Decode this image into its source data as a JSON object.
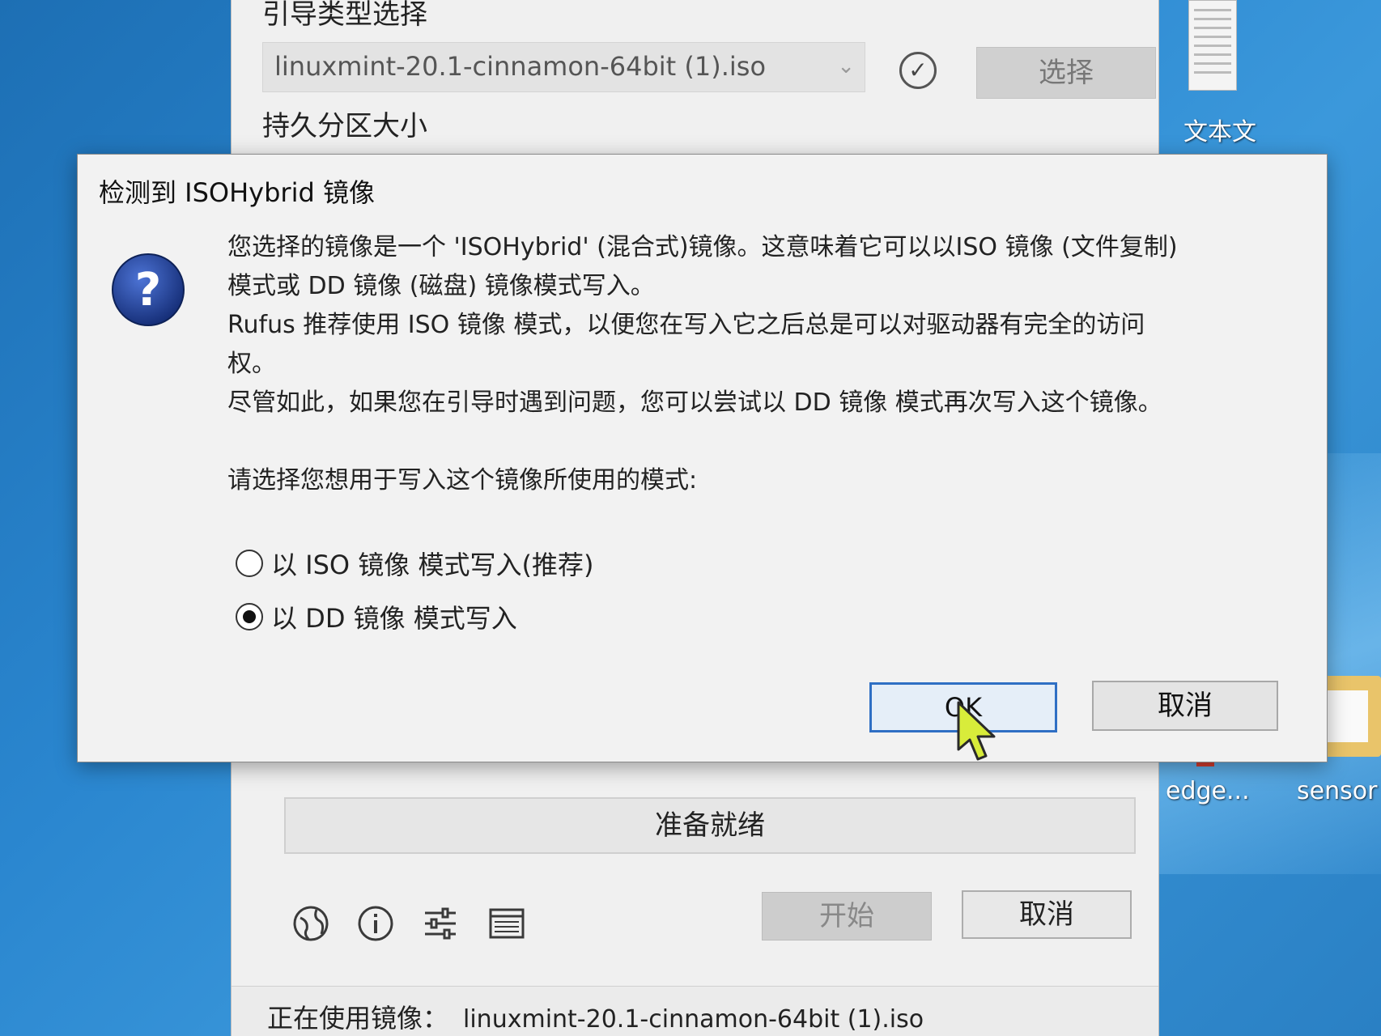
{
  "background_window": {
    "boot_selection_label": "引导类型选择",
    "image_combo_value": "linuxmint-20.1-cinnamon-64bit (1).iso",
    "select_button": "选择",
    "persistent_partition_label": "持久分区大小",
    "status_text": "准备就绪",
    "start_button": "开始",
    "cancel_button": "取消",
    "statusline_prefix": "正在使用镜像：",
    "statusline_value": "linuxmint-20.1-cinnamon-64bit (1).iso"
  },
  "desktop": {
    "icon_labels": [
      "文本文",
      "edge...",
      "sensor"
    ]
  },
  "dialog": {
    "title": "检测到 ISOHybrid 镜像",
    "message_lines": [
      "您选择的镜像是一个 'ISOHybrid' (混合式)镜像。这意味着它可以以ISO 镜像 (文件复制)",
      "模式或 DD 镜像 (磁盘) 镜像模式写入。",
      "Rufus 推荐使用 ISO 镜像 模式，以便您在写入它之后总是可以对驱动器有完全的访问",
      "权。",
      "尽管如此，如果您在引导时遇到问题，您可以尝试以 DD 镜像 模式再次写入这个镜像。"
    ],
    "prompt": "请选择您想用于写入这个镜像所使用的模式:",
    "options": [
      {
        "label": "以 ISO 镜像 模式写入(推荐)",
        "selected": false
      },
      {
        "label": "以 DD 镜像 模式写入",
        "selected": true
      }
    ],
    "ok_button": "OK",
    "cancel_button": "取消"
  },
  "icons": [
    "check-circle-icon",
    "globe-icon",
    "info-icon",
    "settings-sliders-icon",
    "log-icon",
    "question-icon",
    "cursor-icon",
    "document-icon",
    "folder-icon"
  ],
  "colors": {
    "desktop": "#2a86cf",
    "ok_border": "#2f6fc4",
    "question_icon": "#1f3d8c"
  }
}
